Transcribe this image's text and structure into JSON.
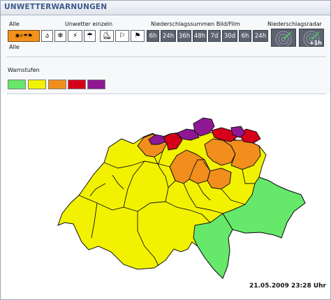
{
  "header": {
    "title": "UNWETTERWARNUNGEN"
  },
  "controls": {
    "alle_label_top": "Alle",
    "alle_label_bottom": "Alle",
    "unwetter_einzeln_label": "Unwetter einzeln",
    "niederschlag_label": "Niederschlagssummen Bild/Film",
    "radar_label": "Niederschlagsradar",
    "radar_plus_label": "+1h",
    "period_buttons": [
      "6h",
      "24h",
      "36h",
      "48h",
      "7d",
      "30d",
      "6h",
      "24h"
    ],
    "icons": [
      "all-weather-icon",
      "wind-icon",
      "snow-icon",
      "thunderstorm-icon",
      "rain-icon",
      "ice-icon",
      "storm-icon",
      "flag-icon"
    ]
  },
  "legend": {
    "title": "Warnstufen",
    "levels": [
      {
        "color": "#66e86a"
      },
      {
        "color": "#f2f200"
      },
      {
        "color": "#f28e1c"
      },
      {
        "color": "#d6001a"
      },
      {
        "color": "#8e1894"
      }
    ]
  },
  "map": {
    "colors": {
      "green": "#66e86a",
      "yellow": "#f2f200",
      "orange": "#f28e1c",
      "red": "#d6001a",
      "purple": "#8e1894",
      "border": "#111111"
    }
  },
  "footer": {
    "timestamp": "21.05.2009 23:28 Uhr"
  }
}
